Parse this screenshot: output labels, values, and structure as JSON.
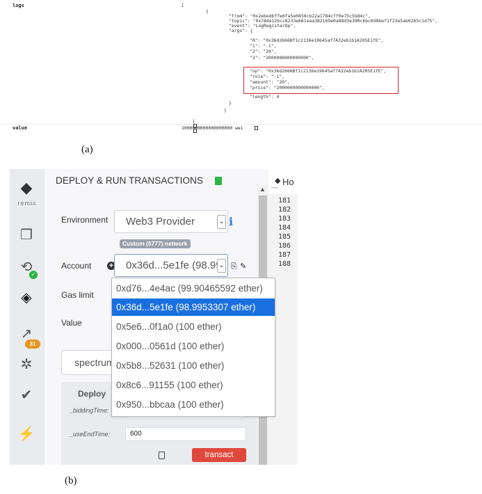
{
  "panel_a": {
    "rows": [
      {
        "label": "logs"
      },
      {
        "label": "value",
        "value": "1000000000000000000 wei"
      }
    ],
    "json_lines": [
      "[",
      "{",
      "\"from\": \"0x2ebedbffe6fa5e0856cb22a1784cff0e75c5b84c\",",
      "\"topic\": \"0x78de12bcc8233e661eaa382169e0a88d3e390c6bc698bef1f23e5ab0265c1d75\",",
      "\"event\": \"LogRegisterOp\",",
      "\"args\": {",
      "\"0\": \"0x36d2666Bf1c2136e19645af7A32eb1b1A205E1fE\",",
      "\"1\": \"-1\",",
      "\"2\": \"20\",",
      "\"3\": \"2000000000000000\",",
      "\"op\": \"0x36d2666Bf1c2136e19645af7A32eb1b1A205E1fE\",",
      "\"role\": \"-1\",",
      "\"amount\": \"20\",",
      "\"price\": \"2000000000000000\",",
      "\"length\": 4",
      "}",
      "}",
      "]"
    ]
  },
  "captions": {
    "a": "(a)",
    "b": "(b)"
  },
  "remix": {
    "brand": "remix",
    "header": {
      "title": "DEPLOY & RUN TRANSACTIONS"
    },
    "badge_count": "31",
    "environment": {
      "label": "Environment",
      "value": "Web3 Provider",
      "network": "Custom (5777) network"
    },
    "account": {
      "label": "Account",
      "value": "0x36d...5e1fe (98.99"
    },
    "gas_limit": {
      "label": "Gas limit"
    },
    "value": {
      "label": "Value"
    },
    "contract_select": {
      "value": "spectrum"
    },
    "deploy": {
      "title": "Deploy",
      "params": [
        {
          "label": "_biddingTime:",
          "value": ""
        },
        {
          "label": "_useEndTime:",
          "value": "600"
        }
      ],
      "transact_label": "transact"
    },
    "editor": {
      "tab_label": "Ho",
      "tab_sub": "remix",
      "line_numbers": [
        "181",
        "182",
        "183",
        "184",
        "185",
        "186",
        "187",
        "188"
      ]
    },
    "account_options": [
      {
        "label": "0xd76...4e4ac (99.90465592 ether)",
        "selected": false
      },
      {
        "label": "0x36d...5e1fe (98.9953307 ether)",
        "selected": true
      },
      {
        "label": "0x5e6...0f1a0 (100 ether)",
        "selected": false
      },
      {
        "label": "0x000...0561d (100 ether)",
        "selected": false
      },
      {
        "label": "0x5b8...52631 (100 ether)",
        "selected": false
      },
      {
        "label": "0x8c6...91155 (100 ether)",
        "selected": false
      },
      {
        "label": "0x950...bbcaa (100 ether)",
        "selected": false
      }
    ],
    "colors": {
      "accent": "#1a6fe0",
      "transact": "#e0483d",
      "badge": "#e8951c",
      "highlight": "#d0262a"
    }
  }
}
